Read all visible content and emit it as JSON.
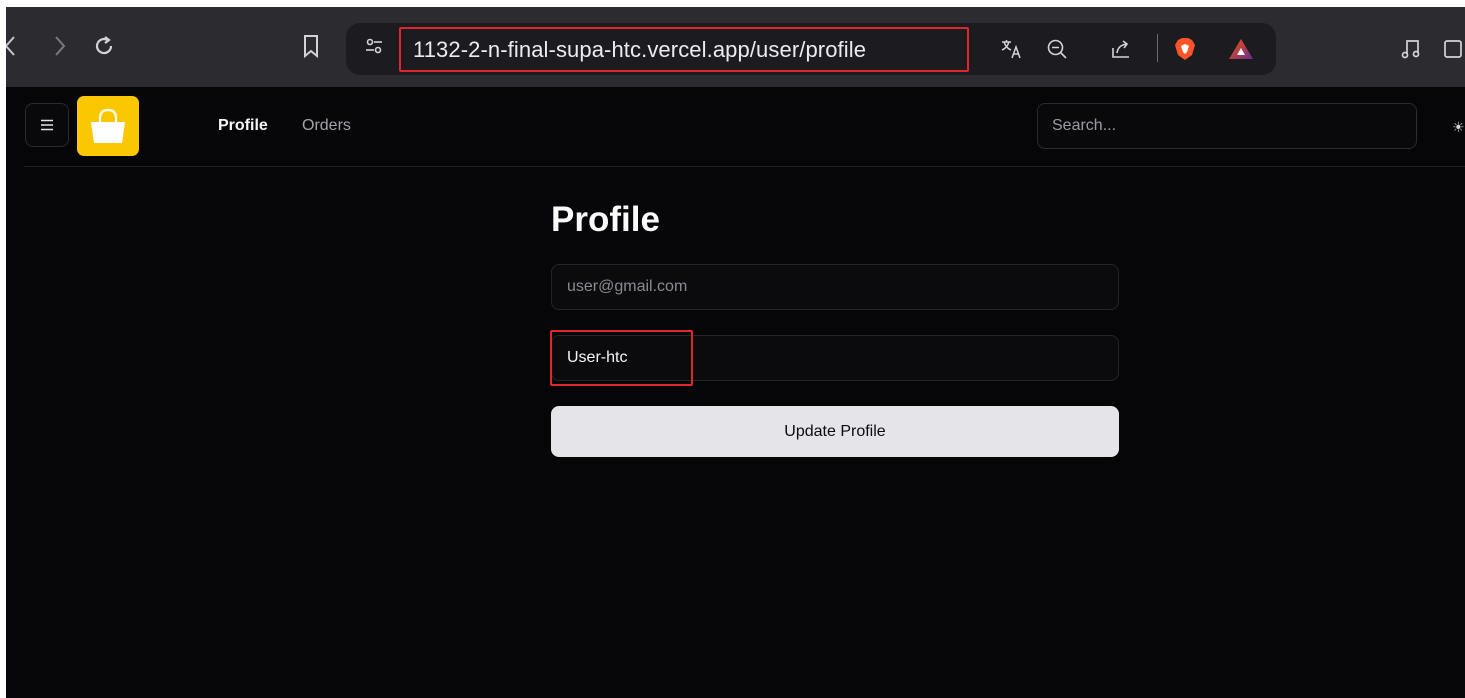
{
  "browser": {
    "url": "1132-2-n-final-supa-htc.vercel.app/user/profile",
    "icons": [
      "back-icon",
      "forward-icon",
      "reload-icon",
      "bookmark-icon",
      "site-settings-icon",
      "translate-icon",
      "zoom-out-icon",
      "share-icon",
      "brave-shields-icon",
      "brave-rewards-icon",
      "media-icon",
      "sidebar-icon"
    ]
  },
  "header": {
    "nav": {
      "profile": "Profile",
      "orders": "Orders"
    },
    "search_placeholder": "Search..."
  },
  "main": {
    "title": "Profile",
    "email_placeholder": "user@gmail.com",
    "name_value": "User-htc",
    "update_button": "Update Profile"
  },
  "colors": {
    "background": "#060609",
    "logo": "#fbc700",
    "highlight": "#e0262b",
    "button": "#e4e4e9"
  }
}
